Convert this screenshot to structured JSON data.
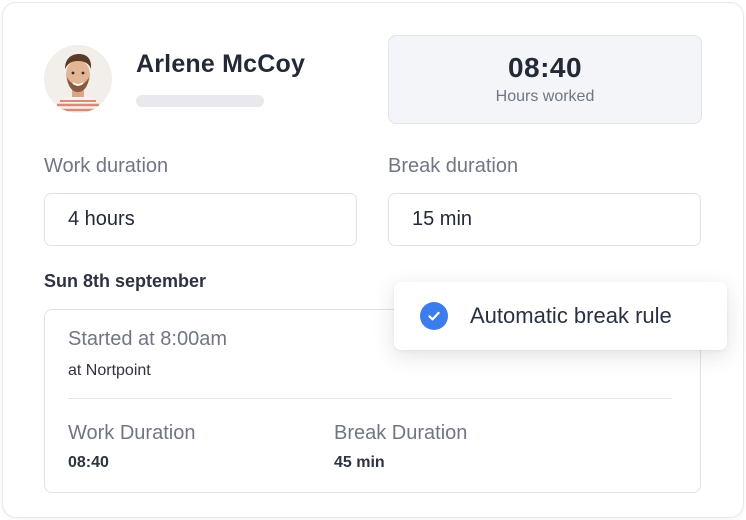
{
  "user": {
    "name": "Arlene McCoy"
  },
  "hours": {
    "value": "08:40",
    "label": "Hours worked"
  },
  "fields": {
    "work_label": "Work duration",
    "work_value": "4 hours",
    "break_label": "Break duration",
    "break_value": "15 min"
  },
  "entry": {
    "date": "Sun 8th september",
    "started": "Started at 8:00am",
    "location": "at Nortpoint",
    "work_label": "Work Duration",
    "work_value": "08:40",
    "break_label": "Break Duration",
    "break_value": "45 min"
  },
  "break_rule": {
    "label": "Automatic break rule",
    "checked": true
  },
  "colors": {
    "accent": "#3b7ded",
    "text": "#232a37",
    "muted": "#6f7684"
  },
  "icons": {
    "check": "check-icon",
    "avatar": "user-avatar"
  }
}
